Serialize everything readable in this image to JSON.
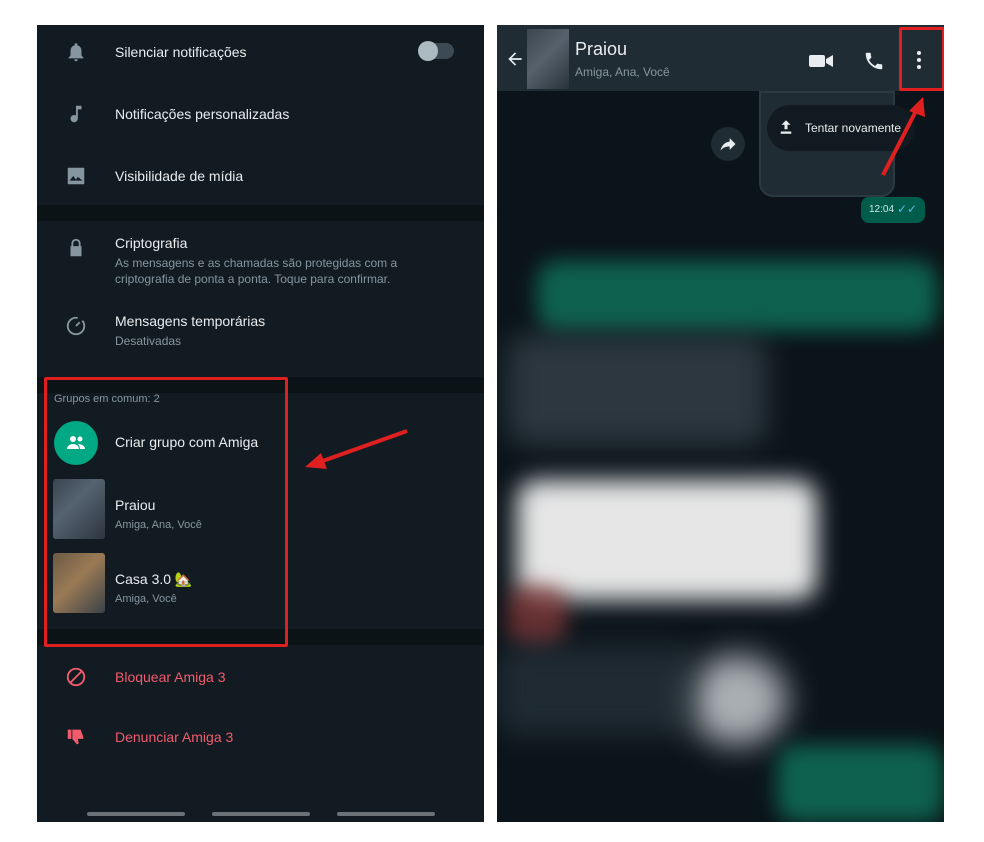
{
  "left": {
    "rows": {
      "mute": {
        "label": "Silenciar notificações"
      },
      "custom": {
        "label": "Notificações personalizadas"
      },
      "media": {
        "label": "Visibilidade de mídia"
      },
      "encryption": {
        "label": "Criptografia",
        "sub": "As mensagens e as chamadas são protegidas com a criptografia de ponta a ponta. Toque para confirmar."
      },
      "disappearing": {
        "label": "Mensagens temporárias",
        "sub": "Desativadas"
      }
    },
    "groups": {
      "header": "Grupos em comum: 2",
      "create_label": "Criar grupo com Amiga",
      "items": [
        {
          "name": "Praiou",
          "members": "Amiga, Ana, Você"
        },
        {
          "name": "Casa 3.0 🏡",
          "members": "Amiga, Você"
        }
      ]
    },
    "actions": {
      "block": "Bloquear Amiga 3",
      "report": "Denunciar Amiga 3"
    }
  },
  "right": {
    "chat": {
      "title": "Praiou",
      "subtitle": "Amiga, Ana, Você"
    },
    "retry_label": "Tentar novamente",
    "message_time": "12:04"
  },
  "colors": {
    "accent": "#00a884",
    "danger": "#f15c6d",
    "highlight": "#e02020"
  }
}
